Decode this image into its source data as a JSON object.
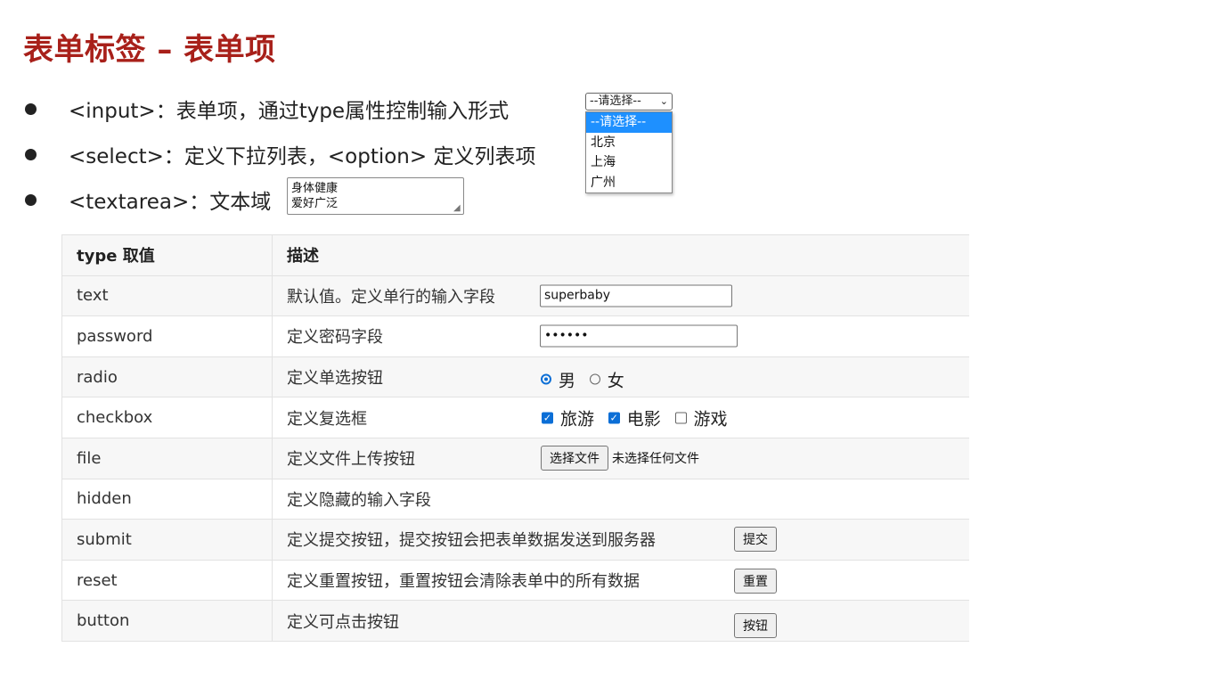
{
  "title": "表单标签 – 表单项",
  "bullets": [
    {
      "text": "<input>：表单项，通过type属性控制输入形式"
    },
    {
      "text": "<select>：定义下拉列表，<option> 定义列表项"
    },
    {
      "text": "<textarea>：文本域"
    }
  ],
  "textarea_demo": {
    "value": "身体健康\n爱好广泛"
  },
  "select_demo": {
    "selected": "--请选择--",
    "options": [
      "--请选择--",
      "北京",
      "上海",
      "广州"
    ]
  },
  "table": {
    "headers": [
      "type 取值",
      "描述"
    ],
    "rows": [
      {
        "type": "text",
        "desc": "默认值。定义单行的输入字段"
      },
      {
        "type": "password",
        "desc": "定义密码字段"
      },
      {
        "type": "radio",
        "desc": "定义单选按钮"
      },
      {
        "type": "checkbox",
        "desc": "定义复选框"
      },
      {
        "type": "file",
        "desc": "定义文件上传按钮"
      },
      {
        "type": "hidden",
        "desc": "定义隐藏的输入字段"
      },
      {
        "type": "submit",
        "desc": "定义提交按钮，提交按钮会把表单数据发送到服务器"
      },
      {
        "type": "reset",
        "desc": "定义重置按钮，重置按钮会清除表单中的所有数据"
      },
      {
        "type": "button",
        "desc": "定义可点击按钮"
      }
    ]
  },
  "demos": {
    "text_value": "superbaby",
    "password_value": "••••••",
    "radio": [
      {
        "label": "男",
        "checked": true
      },
      {
        "label": "女",
        "checked": false
      }
    ],
    "checkbox": [
      {
        "label": "旅游",
        "checked": true
      },
      {
        "label": "电影",
        "checked": true
      },
      {
        "label": "游戏",
        "checked": false
      }
    ],
    "file_button": "选择文件",
    "file_status": "未选择任何文件",
    "submit_label": "提交",
    "reset_label": "重置",
    "button_label": "按钮"
  },
  "colors": {
    "title": "#a8201a",
    "accent": "#0b6ed6",
    "select_highlight": "#1e90ff"
  }
}
